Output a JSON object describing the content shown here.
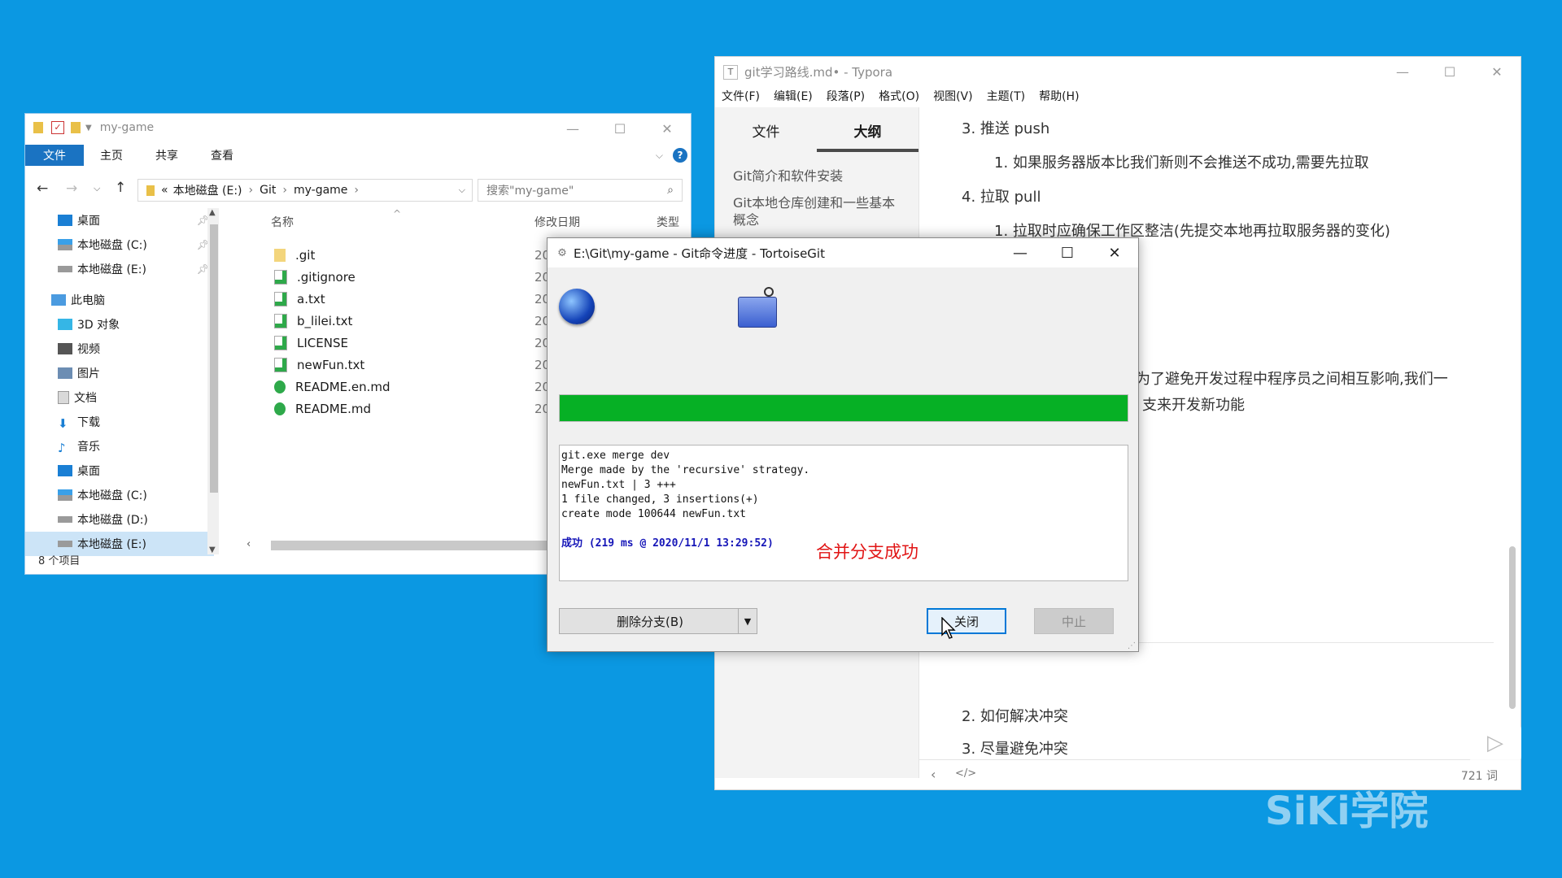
{
  "explorer": {
    "title": "my-game",
    "ribbon_tabs": [
      "文件",
      "主页",
      "共享",
      "查看"
    ],
    "address": {
      "prefix": "«",
      "crumbs": [
        "本地磁盘 (E:)",
        "Git",
        "my-game"
      ]
    },
    "search_placeholder": "搜索\"my-game\"",
    "nav": [
      {
        "label": "桌面",
        "pinned": true
      },
      {
        "label": "本地磁盘 (C:)",
        "pinned": true
      },
      {
        "label": "本地磁盘 (E:)",
        "pinned": true
      },
      {
        "label": "此电脑",
        "pinned": false
      },
      {
        "label": "3D 对象",
        "pinned": false
      },
      {
        "label": "视频",
        "pinned": false
      },
      {
        "label": "图片",
        "pinned": false
      },
      {
        "label": "文档",
        "pinned": false
      },
      {
        "label": "下载",
        "pinned": false
      },
      {
        "label": "音乐",
        "pinned": false
      },
      {
        "label": "桌面",
        "pinned": false
      },
      {
        "label": "本地磁盘 (C:)",
        "pinned": false
      },
      {
        "label": "本地磁盘 (D:)",
        "pinned": false
      },
      {
        "label": "本地磁盘 (E:)",
        "pinned": false
      }
    ],
    "columns": [
      "名称",
      "修改日期",
      "类型"
    ],
    "files": [
      {
        "name": ".git",
        "date": "2020/"
      },
      {
        "name": ".gitignore",
        "date": "2020/"
      },
      {
        "name": "a.txt",
        "date": "2020/"
      },
      {
        "name": "b_lilei.txt",
        "date": "2020/"
      },
      {
        "name": "LICENSE",
        "date": "2020/"
      },
      {
        "name": "newFun.txt",
        "date": "2020/"
      },
      {
        "name": "README.en.md",
        "date": "2020/"
      },
      {
        "name": "README.md",
        "date": "2020/"
      }
    ],
    "status": "8 个项目"
  },
  "typora": {
    "title": "git学习路线.md• - Typora",
    "menu": [
      "文件(F)",
      "编辑(E)",
      "段落(P)",
      "格式(O)",
      "视图(V)",
      "主题(T)",
      "帮助(H)"
    ],
    "sidebar_tabs": [
      "文件",
      "大纲"
    ],
    "outline": [
      "Git简介和软件安装",
      "Git本地仓库创建和一些基本概念"
    ],
    "doc": {
      "l1": "3. 推送 push",
      "l2": "1. 如果服务器版本比我们新则不会推送不成功,需要先拉取",
      "l3": "4. 拉取 pull",
      "l4": "1. 拉取时应确保工作区整洁(先提交本地再拉取服务器的变化)",
      "l5": "为了避免开发过程中程序员之间相互影响,我们一",
      "l6": "支来开发新功能",
      "l7": "2. 如何解决冲突",
      "l8": "3. 尽量避免冲突"
    },
    "word_count": "721 词"
  },
  "tgit": {
    "title": "E:\\Git\\my-game - Git命令进度 - TortoiseGit",
    "progress": 1.0,
    "log": [
      "git.exe merge dev",
      "Merge made by the 'recursive' strategy.",
      "newFun.txt | 3 +++",
      "1 file changed, 3 insertions(+)",
      "create mode 100644 newFun.txt"
    ],
    "success": "成功 (219 ms @ 2020/11/1 13:29:52)",
    "annotation": "合并分支成功",
    "btn_delete_branch": "删除分支(B)",
    "btn_close": "关闭",
    "btn_abort": "中止"
  },
  "watermark": "SiKi学院",
  "colors": {
    "desktop": "#0b98e2",
    "progress": "#06b025",
    "ribbon_active": "#1a73c2",
    "annotation": "#e11515",
    "success_text": "#1616b8"
  }
}
